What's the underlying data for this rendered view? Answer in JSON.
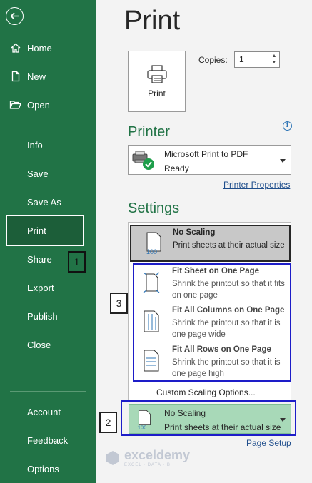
{
  "title": "Print",
  "sidebar": {
    "back_label": "back",
    "items": [
      {
        "label": "Home"
      },
      {
        "label": "New"
      },
      {
        "label": "Open"
      },
      {
        "label": "Info"
      },
      {
        "label": "Save"
      },
      {
        "label": "Save As"
      },
      {
        "label": "Print"
      },
      {
        "label": "Share"
      },
      {
        "label": "Export"
      },
      {
        "label": "Publish"
      },
      {
        "label": "Close"
      }
    ],
    "bottom_items": [
      {
        "label": "Account"
      },
      {
        "label": "Feedback"
      },
      {
        "label": "Options"
      }
    ]
  },
  "print_button": {
    "label": "Print"
  },
  "copies": {
    "label": "Copies:",
    "value": "1"
  },
  "printer": {
    "heading": "Printer",
    "name": "Microsoft Print to PDF",
    "status": "Ready",
    "properties_link": "Printer Properties"
  },
  "settings": {
    "heading": "Settings",
    "options": [
      {
        "title": "No Scaling",
        "desc": "Print sheets at their actual size"
      },
      {
        "title": "Fit Sheet on One Page",
        "desc": "Shrink the printout so that it fits on one page"
      },
      {
        "title": "Fit All Columns on One Page",
        "desc": "Shrink the printout so that it is one page wide"
      },
      {
        "title": "Fit All Rows on One Page",
        "desc": "Shrink the printout so that it is one page high"
      }
    ],
    "custom_option": "Custom Scaling Options...",
    "current": {
      "title": "No Scaling",
      "desc": "Print sheets at their actual size"
    },
    "page_setup_link": "Page Setup"
  },
  "annotations": {
    "one": "1",
    "two": "2",
    "three": "3"
  },
  "watermark": {
    "name": "exceldemy",
    "sub": "EXCEL · DATA · BI"
  },
  "colors": {
    "accent": "#217346",
    "annotation_blue": "#1d1dc8",
    "link": "#1f4e8c"
  }
}
